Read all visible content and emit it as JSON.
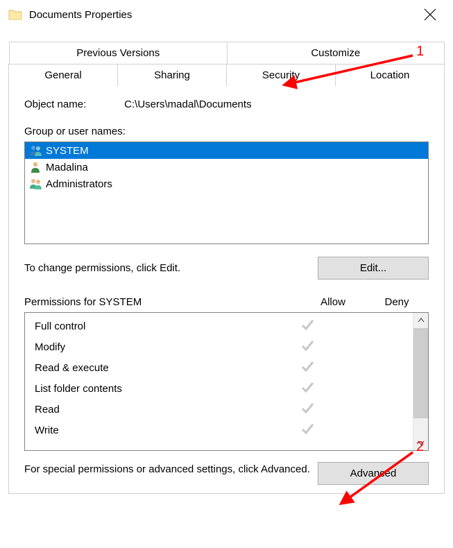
{
  "window": {
    "title": "Documents Properties"
  },
  "tabs": {
    "row1": [
      "Previous Versions",
      "Customize"
    ],
    "row2": [
      "General",
      "Sharing",
      "Security",
      "Location"
    ],
    "active": "Security"
  },
  "security": {
    "object_name_label": "Object name:",
    "object_name_value": "C:\\Users\\madal\\Documents",
    "group_label": "Group or user names:",
    "principals": [
      {
        "name": "SYSTEM",
        "icon": "users",
        "selected": true
      },
      {
        "name": "Madalina",
        "icon": "user",
        "selected": false
      },
      {
        "name": "Administrators",
        "icon": "users",
        "selected": false
      }
    ],
    "edit_text": "To change permissions, click Edit.",
    "edit_button": "Edit...",
    "permissions_for_label": "Permissions for SYSTEM",
    "allow_label": "Allow",
    "deny_label": "Deny",
    "permissions": [
      {
        "name": "Full control",
        "allow": true,
        "deny": false
      },
      {
        "name": "Modify",
        "allow": true,
        "deny": false
      },
      {
        "name": "Read & execute",
        "allow": true,
        "deny": false
      },
      {
        "name": "List folder contents",
        "allow": true,
        "deny": false
      },
      {
        "name": "Read",
        "allow": true,
        "deny": false
      },
      {
        "name": "Write",
        "allow": true,
        "deny": false
      }
    ],
    "advanced_text": "For special permissions or advanced settings, click Advanced.",
    "advanced_button": "Advanced"
  },
  "annotations": {
    "label1": "1",
    "label2": "2"
  }
}
